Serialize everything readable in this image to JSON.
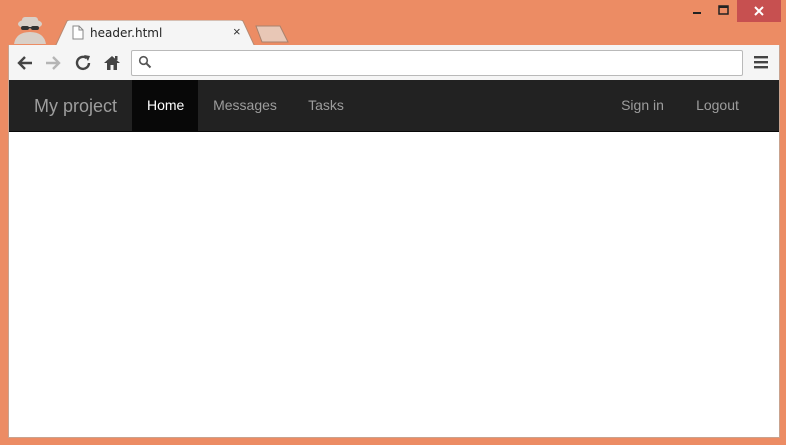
{
  "browser": {
    "tab_title": "header.html",
    "tab_close": "×",
    "address_value": "",
    "address_placeholder": ""
  },
  "navbar": {
    "brand": "My project",
    "left_links": [
      {
        "label": "Home",
        "active": true
      },
      {
        "label": "Messages",
        "active": false
      },
      {
        "label": "Tasks",
        "active": false
      }
    ],
    "right_links": [
      {
        "label": "Sign in"
      },
      {
        "label": "Logout"
      }
    ]
  },
  "colors": {
    "window_frame": "#ec8c64",
    "navbar_bg": "#222222",
    "navbar_active_bg": "#080808",
    "navbar_link": "#9d9d9d",
    "close_button": "#c75050"
  },
  "icons": {
    "profile": "incognito-icon",
    "back": "back-arrow-icon",
    "forward": "forward-arrow-icon",
    "reload": "reload-icon",
    "home": "home-icon",
    "search": "search-icon",
    "menu": "hamburger-menu-icon"
  }
}
